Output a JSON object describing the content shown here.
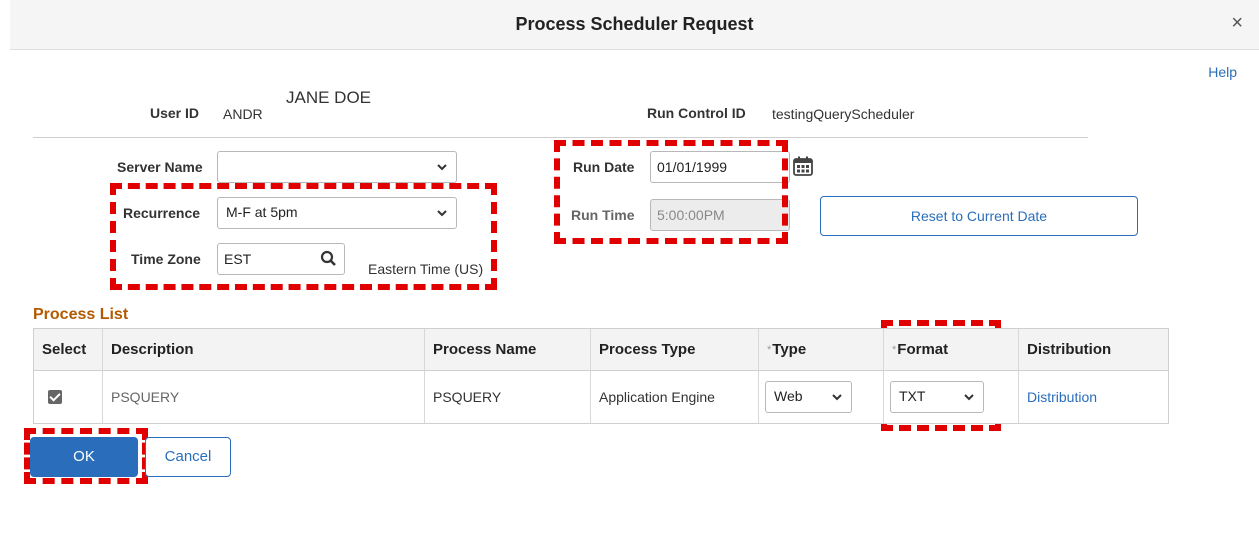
{
  "dialog": {
    "title": "Process Scheduler Request",
    "close": "×",
    "help": "Help"
  },
  "header": {
    "user_id_label": "User ID",
    "user_id_value": "ANDR",
    "user_name_overlay": "JANE DOE",
    "run_control_label": "Run Control ID",
    "run_control_value": "testingQueryScheduler"
  },
  "form": {
    "server_name_label": "Server Name",
    "server_name_value": "",
    "recurrence_label": "Recurrence",
    "recurrence_value": "M-F at 5pm",
    "time_zone_label": "Time Zone",
    "time_zone_value": "EST",
    "time_zone_desc": "Eastern Time (US)",
    "run_date_label": "Run Date",
    "run_date_value": "01/01/1999",
    "run_time_label": "Run Time",
    "run_time_value": "5:00:00PM",
    "reset_button": "Reset to Current Date"
  },
  "process_list": {
    "title": "Process List",
    "headers": {
      "select": "Select",
      "description": "Description",
      "process_name": "Process Name",
      "process_type": "Process Type",
      "type": "Type",
      "format": "Format",
      "distribution": "Distribution",
      "required_mark": "*"
    },
    "row": {
      "selected": true,
      "description": "PSQUERY",
      "process_name": "PSQUERY",
      "process_type": "Application Engine",
      "type": "Web",
      "format": "TXT",
      "distribution": "Distribution"
    }
  },
  "buttons": {
    "ok": "OK",
    "cancel": "Cancel"
  },
  "colors": {
    "accent": "#2a6ebb",
    "highlight": "#e00000",
    "section_title": "#b35a00"
  },
  "icons": [
    "close-icon",
    "chevron-down-icon",
    "search-icon",
    "calendar-icon",
    "checkbox-checked-icon"
  ]
}
